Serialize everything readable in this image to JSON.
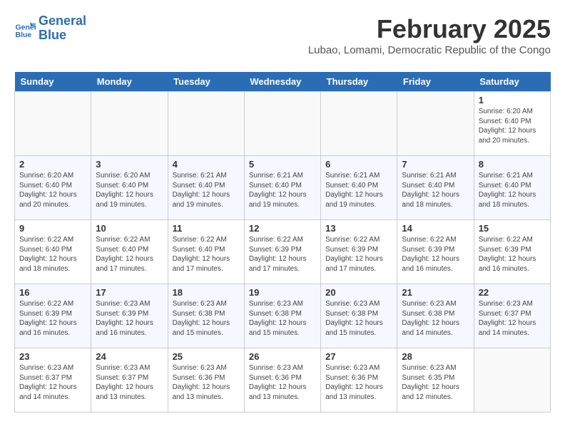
{
  "logo": {
    "text_line1": "General",
    "text_line2": "Blue"
  },
  "title": "February 2025",
  "subtitle": "Lubao, Lomami, Democratic Republic of the Congo",
  "days_of_week": [
    "Sunday",
    "Monday",
    "Tuesday",
    "Wednesday",
    "Thursday",
    "Friday",
    "Saturday"
  ],
  "weeks": [
    [
      {
        "day": "",
        "info": ""
      },
      {
        "day": "",
        "info": ""
      },
      {
        "day": "",
        "info": ""
      },
      {
        "day": "",
        "info": ""
      },
      {
        "day": "",
        "info": ""
      },
      {
        "day": "",
        "info": ""
      },
      {
        "day": "1",
        "info": "Sunrise: 6:20 AM\nSunset: 6:40 PM\nDaylight: 12 hours and 20 minutes."
      }
    ],
    [
      {
        "day": "2",
        "info": "Sunrise: 6:20 AM\nSunset: 6:40 PM\nDaylight: 12 hours and 20 minutes."
      },
      {
        "day": "3",
        "info": "Sunrise: 6:20 AM\nSunset: 6:40 PM\nDaylight: 12 hours and 19 minutes."
      },
      {
        "day": "4",
        "info": "Sunrise: 6:21 AM\nSunset: 6:40 PM\nDaylight: 12 hours and 19 minutes."
      },
      {
        "day": "5",
        "info": "Sunrise: 6:21 AM\nSunset: 6:40 PM\nDaylight: 12 hours and 19 minutes."
      },
      {
        "day": "6",
        "info": "Sunrise: 6:21 AM\nSunset: 6:40 PM\nDaylight: 12 hours and 19 minutes."
      },
      {
        "day": "7",
        "info": "Sunrise: 6:21 AM\nSunset: 6:40 PM\nDaylight: 12 hours and 18 minutes."
      },
      {
        "day": "8",
        "info": "Sunrise: 6:21 AM\nSunset: 6:40 PM\nDaylight: 12 hours and 18 minutes."
      }
    ],
    [
      {
        "day": "9",
        "info": "Sunrise: 6:22 AM\nSunset: 6:40 PM\nDaylight: 12 hours and 18 minutes."
      },
      {
        "day": "10",
        "info": "Sunrise: 6:22 AM\nSunset: 6:40 PM\nDaylight: 12 hours and 17 minutes."
      },
      {
        "day": "11",
        "info": "Sunrise: 6:22 AM\nSunset: 6:40 PM\nDaylight: 12 hours and 17 minutes."
      },
      {
        "day": "12",
        "info": "Sunrise: 6:22 AM\nSunset: 6:39 PM\nDaylight: 12 hours and 17 minutes."
      },
      {
        "day": "13",
        "info": "Sunrise: 6:22 AM\nSunset: 6:39 PM\nDaylight: 12 hours and 17 minutes."
      },
      {
        "day": "14",
        "info": "Sunrise: 6:22 AM\nSunset: 6:39 PM\nDaylight: 12 hours and 16 minutes."
      },
      {
        "day": "15",
        "info": "Sunrise: 6:22 AM\nSunset: 6:39 PM\nDaylight: 12 hours and 16 minutes."
      }
    ],
    [
      {
        "day": "16",
        "info": "Sunrise: 6:22 AM\nSunset: 6:39 PM\nDaylight: 12 hours and 16 minutes."
      },
      {
        "day": "17",
        "info": "Sunrise: 6:23 AM\nSunset: 6:39 PM\nDaylight: 12 hours and 16 minutes."
      },
      {
        "day": "18",
        "info": "Sunrise: 6:23 AM\nSunset: 6:38 PM\nDaylight: 12 hours and 15 minutes."
      },
      {
        "day": "19",
        "info": "Sunrise: 6:23 AM\nSunset: 6:38 PM\nDaylight: 12 hours and 15 minutes."
      },
      {
        "day": "20",
        "info": "Sunrise: 6:23 AM\nSunset: 6:38 PM\nDaylight: 12 hours and 15 minutes."
      },
      {
        "day": "21",
        "info": "Sunrise: 6:23 AM\nSunset: 6:38 PM\nDaylight: 12 hours and 14 minutes."
      },
      {
        "day": "22",
        "info": "Sunrise: 6:23 AM\nSunset: 6:37 PM\nDaylight: 12 hours and 14 minutes."
      }
    ],
    [
      {
        "day": "23",
        "info": "Sunrise: 6:23 AM\nSunset: 6:37 PM\nDaylight: 12 hours and 14 minutes."
      },
      {
        "day": "24",
        "info": "Sunrise: 6:23 AM\nSunset: 6:37 PM\nDaylight: 12 hours and 13 minutes."
      },
      {
        "day": "25",
        "info": "Sunrise: 6:23 AM\nSunset: 6:36 PM\nDaylight: 12 hours and 13 minutes."
      },
      {
        "day": "26",
        "info": "Sunrise: 6:23 AM\nSunset: 6:36 PM\nDaylight: 12 hours and 13 minutes."
      },
      {
        "day": "27",
        "info": "Sunrise: 6:23 AM\nSunset: 6:36 PM\nDaylight: 12 hours and 13 minutes."
      },
      {
        "day": "28",
        "info": "Sunrise: 6:23 AM\nSunset: 6:35 PM\nDaylight: 12 hours and 12 minutes."
      },
      {
        "day": "",
        "info": ""
      }
    ]
  ]
}
